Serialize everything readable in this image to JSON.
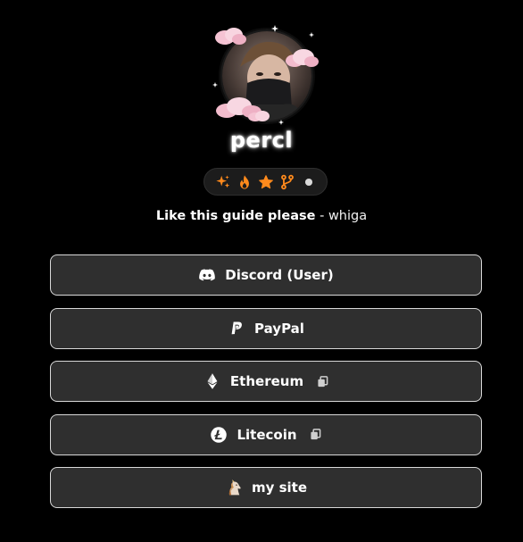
{
  "profile": {
    "username": "percl",
    "avatar_icon": "avatar-photo",
    "badges": [
      {
        "icon": "sparkles-icon",
        "color": "#ff8a1c"
      },
      {
        "icon": "flame-icon",
        "color": "#ff8a1c"
      },
      {
        "icon": "star-icon",
        "color": "#ff8a1c"
      },
      {
        "icon": "git-branch-icon",
        "color": "#ff8a1c"
      },
      {
        "icon": "status-dot-icon",
        "color": "#d9d9d9"
      }
    ]
  },
  "quote": {
    "text": "Like this guide please",
    "separator": " - ",
    "author": "whiga"
  },
  "links": [
    {
      "label": "Discord (User)",
      "icon": "discord-icon",
      "copy": false
    },
    {
      "label": "PayPal",
      "icon": "paypal-icon",
      "copy": false
    },
    {
      "label": "Ethereum",
      "icon": "ethereum-icon",
      "copy": true
    },
    {
      "label": "Litecoin",
      "icon": "litecoin-icon",
      "copy": true
    },
    {
      "label": "my site",
      "icon": "unicorn-icon",
      "copy": false
    }
  ],
  "colors": {
    "background": "#000000",
    "button_bg": "#2f2f2f",
    "button_border": "#d9d9d9",
    "badge_accent": "#ff8a1c",
    "cloud_pink": "#f7c6d6"
  }
}
